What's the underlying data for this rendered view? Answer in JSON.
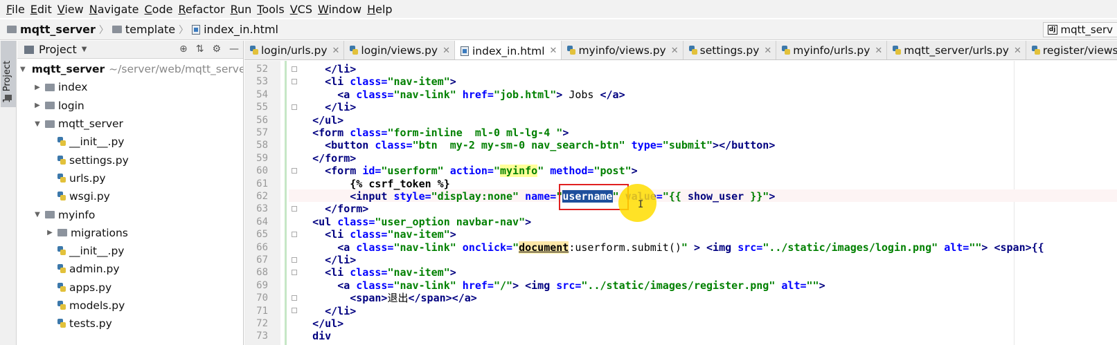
{
  "menu": {
    "items": [
      {
        "label": "File",
        "mnemonic": "F",
        "rest": "ile"
      },
      {
        "label": "Edit",
        "mnemonic": "E",
        "rest": "dit"
      },
      {
        "label": "View",
        "mnemonic": "V",
        "rest": "iew"
      },
      {
        "label": "Navigate",
        "mnemonic": "N",
        "rest": "avigate"
      },
      {
        "label": "Code",
        "mnemonic": "C",
        "rest": "ode"
      },
      {
        "label": "Refactor",
        "mnemonic": "R",
        "rest": "efactor"
      },
      {
        "label": "Run",
        "mnemonic": "R",
        "rest": "un"
      },
      {
        "label": "Tools",
        "mnemonic": "T",
        "rest": "ools"
      },
      {
        "label": "VCS",
        "mnemonic": "V",
        "rest": "CS"
      },
      {
        "label": "Window",
        "mnemonic": "W",
        "rest": "indow"
      },
      {
        "label": "Help",
        "mnemonic": "H",
        "rest": "elp"
      }
    ]
  },
  "breadcrumb": {
    "project": "mqtt_server",
    "folder": "template",
    "file": "index_in.html"
  },
  "run_config": {
    "label": "mqtt_serv"
  },
  "left_strip": {
    "tab_label": "1: Project"
  },
  "project_panel": {
    "title": "Project",
    "root_name": "mqtt_server",
    "root_path": "~/server/web/mqtt_server",
    "items": [
      {
        "name": "index",
        "type": "folder"
      },
      {
        "name": "login",
        "type": "folder"
      },
      {
        "name": "mqtt_server",
        "type": "folder"
      },
      {
        "name": "__init__.py",
        "type": "py"
      },
      {
        "name": "settings.py",
        "type": "py"
      },
      {
        "name": "urls.py",
        "type": "py"
      },
      {
        "name": "wsgi.py",
        "type": "py"
      },
      {
        "name": "myinfo",
        "type": "folder"
      },
      {
        "name": "migrations",
        "type": "folder"
      },
      {
        "name": "__init__.py",
        "type": "py"
      },
      {
        "name": "admin.py",
        "type": "py"
      },
      {
        "name": "apps.py",
        "type": "py"
      },
      {
        "name": "models.py",
        "type": "py"
      },
      {
        "name": "tests.py",
        "type": "py"
      }
    ]
  },
  "tabs": [
    {
      "label": "login/urls.py",
      "active": false
    },
    {
      "label": "login/views.py",
      "active": false
    },
    {
      "label": "index_in.html",
      "active": true
    },
    {
      "label": "myinfo/views.py",
      "active": false
    },
    {
      "label": "settings.py",
      "active": false
    },
    {
      "label": "myinfo/urls.py",
      "active": false
    },
    {
      "label": "mqtt_server/urls.py",
      "active": false
    },
    {
      "label": "register/views.py",
      "active": false
    }
  ],
  "editor": {
    "line_numbers": [
      "52",
      "53",
      "54",
      "55",
      "56",
      "57",
      "58",
      "59",
      "60",
      "61",
      "62",
      "63",
      "64",
      "65",
      "66",
      "67",
      "68",
      "69",
      "70",
      "71",
      "72",
      "73"
    ],
    "selected_word": "username",
    "lines": {
      "l52": "</li>",
      "l53_tag": "<li ",
      "l53_attr": "class=",
      "l53_val": "\"nav-item\"",
      "l53_end": ">",
      "l54_tag": "<a ",
      "l54_attr1": "class=",
      "l54_val1": "\"nav-link\"",
      "l54_attr2": " href=",
      "l54_val2": "\"job.html\"",
      "l54_mid": ">",
      "l54_text": " Jobs ",
      "l54_close": "</a>",
      "l55": "</li>",
      "l56": "</ul>",
      "l57_tag": "<form ",
      "l57_attr": "class=",
      "l57_val": "\"form-inline  ml-0 ml-lg-4 \"",
      "l57_end": ">",
      "l58_tag": "<button ",
      "l58_attr1": "class=",
      "l58_val1": "\"btn  my-2 my-sm-0 nav_search-btn\"",
      "l58_attr2": " type=",
      "l58_val2": "\"submit\"",
      "l58_end": "></button>",
      "l59": "</form>",
      "l60_tag": "<form ",
      "l60_attr1": "id=",
      "l60_val1": "\"userform\"",
      "l60_attr2": " action=",
      "l60_val2a": "\"",
      "l60_val2b": "myinfo",
      "l60_val2c": "\"",
      "l60_attr3": " method=",
      "l60_val3": "\"post\"",
      "l60_end": ">",
      "l61": "{% csrf_token %}",
      "l62_tag": "<input ",
      "l62_attr1": "style=",
      "l62_val1": "\"display:none\"",
      "l62_attr2": " name=",
      "l62_q1": "\"",
      "l62_q2": "\"",
      "l62_attr3": " value=",
      "l62_val3a": "\"{{ ",
      "l62_val3b": "show_user",
      "l62_val3c": " }}\"",
      "l62_end": ">",
      "l63": "</form>",
      "l64_tag": "<ul ",
      "l64_attr": "class=",
      "l64_val": "\"user_option navbar-nav\"",
      "l64_end": ">",
      "l65_tag": "<li ",
      "l65_attr": "class=",
      "l65_val": "\"nav-item\"",
      "l65_end": ">",
      "l66_tag": "<a ",
      "l66_attr1": "class=",
      "l66_val1": "\"nav-link\"",
      "l66_attr2": " onclick=",
      "l66_q": "\"",
      "l66_doc": "document",
      "l66_rest": ":userform.submit()",
      "l66_q2": "\"",
      "l66_mid": " > ",
      "l66_img": "<img ",
      "l66_src": "src=",
      "l66_srcv": "\"../static/images/login.png\"",
      "l66_alt": " alt=",
      "l66_altv": "\"\"",
      "l66_end": "> ",
      "l66_span": "<span>{{",
      "l67": "</li>",
      "l68_tag": "<li ",
      "l68_attr": "class=",
      "l68_val": "\"nav-item\"",
      "l68_end": ">",
      "l69_tag": "<a ",
      "l69_attr1": "class=",
      "l69_val1": "\"nav-link\"",
      "l69_attr2": " href=",
      "l69_val2": "\"/\"",
      "l69_mid": "> ",
      "l69_img": "<img ",
      "l69_src": "src=",
      "l69_srcv": "\"../static/images/register.png\"",
      "l69_alt": " alt=",
      "l69_altv": "\"\"",
      "l69_end": ">",
      "l70_open": "<span>",
      "l70_text": "退出",
      "l70_close": "</span></a>",
      "l71": "</li>",
      "l72": "</ul>",
      "l73": "div"
    }
  }
}
